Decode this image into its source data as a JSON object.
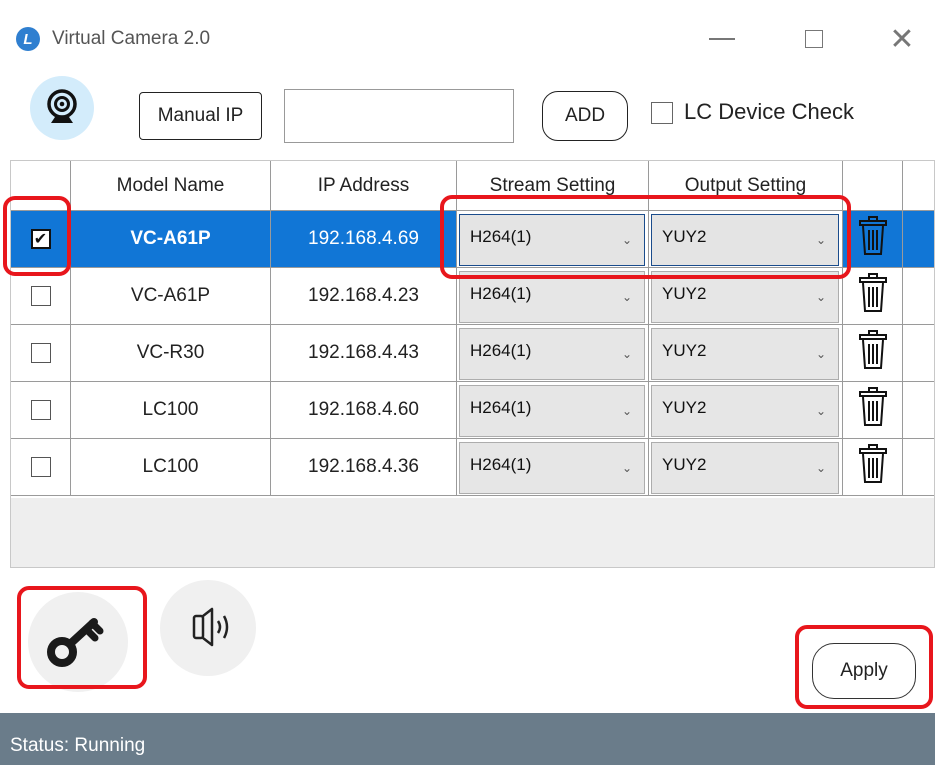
{
  "window": {
    "title": "Virtual Camera 2.0",
    "app_icon_letter": "L",
    "minimize_label": "",
    "maximize_label": "",
    "close_label": "✕"
  },
  "toolbar": {
    "manual_ip_label": "Manual IP",
    "ip_input_value": "",
    "ip_input_placeholder": "",
    "add_label": "ADD",
    "lc_device_check_label": "LC Device Check",
    "lc_device_check_checked": false
  },
  "table": {
    "columns": [
      "",
      "Model Name",
      "IP Address",
      "Stream Setting",
      "Output Setting",
      ""
    ],
    "rows": [
      {
        "checked": true,
        "checkmark": "✔",
        "model": "VC-A61P",
        "ip": "192.168.4.69",
        "stream": "H264(1)",
        "output": "YUY2",
        "selected": true
      },
      {
        "checked": false,
        "checkmark": "",
        "model": "VC-A61P",
        "ip": "192.168.4.23",
        "stream": "H264(1)",
        "output": "YUY2",
        "selected": false
      },
      {
        "checked": false,
        "checkmark": "",
        "model": "VC-R30",
        "ip": "192.168.4.43",
        "stream": "H264(1)",
        "output": "YUY2",
        "selected": false
      },
      {
        "checked": false,
        "checkmark": "",
        "model": "LC100",
        "ip": "192.168.4.60",
        "stream": "H264(1)",
        "output": "YUY2",
        "selected": false
      },
      {
        "checked": false,
        "checkmark": "",
        "model": "LC100",
        "ip": "192.168.4.36",
        "stream": "H264(1)",
        "output": "YUY2",
        "selected": false
      }
    ],
    "combo_arrow": "⌄"
  },
  "bottom": {
    "apply_label": "Apply",
    "status_text": "Status: Running"
  },
  "icons": {
    "app": "app-logo-icon",
    "camera": "webcam-icon",
    "key": "key-icon",
    "vibrate": "vibrate-icon",
    "trash": "trash-icon"
  },
  "colors": {
    "selection": "#1176d6",
    "status_bar": "#6a7c8a",
    "highlight": "#e8161c",
    "camera_bg": "#d3ecfb"
  }
}
